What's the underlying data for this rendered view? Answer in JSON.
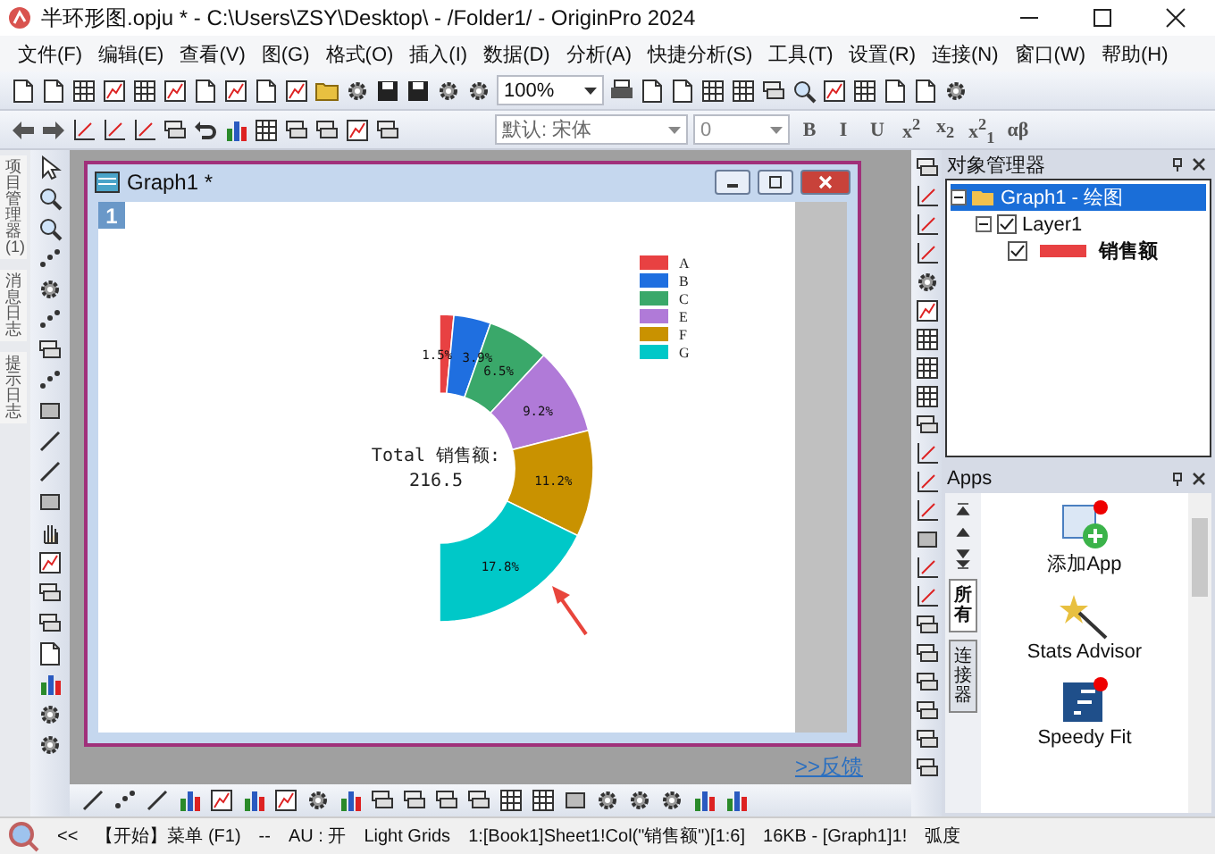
{
  "window": {
    "title": "半环形图.opju * - C:\\Users\\ZSY\\Desktop\\ - /Folder1/ - OriginPro 2024"
  },
  "menu": [
    "文件(F)",
    "编辑(E)",
    "查看(V)",
    "图(G)",
    "格式(O)",
    "插入(I)",
    "数据(D)",
    "分析(A)",
    "快捷分析(S)",
    "工具(T)",
    "设置(R)",
    "连接(N)",
    "窗口(W)",
    "帮助(H)"
  ],
  "toolbar": {
    "zoom": "100%",
    "font": "默认: 宋体",
    "font_size": "0",
    "format_buttons": [
      "B",
      "I",
      "U",
      "x$^{2}$",
      "x$_{2}$",
      "x$^{2}$$_{1}$",
      "αβ"
    ]
  },
  "left_tabs": [
    "项目管理器 (1)",
    "消息日志",
    "提示日志"
  ],
  "graph": {
    "title": "Graph1 *",
    "layer": "1",
    "slices": [
      {
        "color": "#e84142"
      },
      {
        "color": "#1f6fe0"
      },
      {
        "color": "#3aa86a"
      },
      {
        "color": "#b07ad8"
      },
      {
        "color": "#c99200"
      },
      {
        "color": "#00c8c8"
      }
    ],
    "chart_data": {
      "type": "donut",
      "legend": "upper right",
      "categories": [
        "A",
        "B",
        "C",
        "E",
        "F",
        "G"
      ],
      "values": [
        1.5,
        3.9,
        6.5,
        9.2,
        11.2,
        17.8
      ],
      "value_labels": [
        "1.5%",
        "3.9%",
        "6.5%",
        "9.2%",
        "11.2%",
        "17.8%"
      ],
      "annotations": [
        "Total 销售额:",
        "216.5"
      ]
    }
  },
  "feedback_link": ">>反馈",
  "object_manager": {
    "title": "对象管理器",
    "tree": [
      {
        "label": "Graph1 - 绘图",
        "selected": true,
        "expanded": true,
        "children": [
          {
            "label": "Layer1",
            "checked": true,
            "expanded": true,
            "children": [
              {
                "label": "销售额",
                "checked": true,
                "color": "#e84142"
              }
            ]
          }
        ]
      }
    ]
  },
  "apps": {
    "title": "Apps",
    "tabs": [
      {
        "label": "所有",
        "selected": true
      },
      {
        "label": "连接器",
        "selected": false
      }
    ],
    "items": [
      "添加App",
      "Stats Advisor",
      "Speedy Fit"
    ]
  },
  "status_bar": [
    "<<",
    "【开始】菜单 (F1)",
    "--",
    "AU : 开",
    "Light Grids",
    "1:[Book1]Sheet1!Col(\"销售额\")[1:6]",
    "16KB - [Graph1]1!",
    "弧度"
  ]
}
